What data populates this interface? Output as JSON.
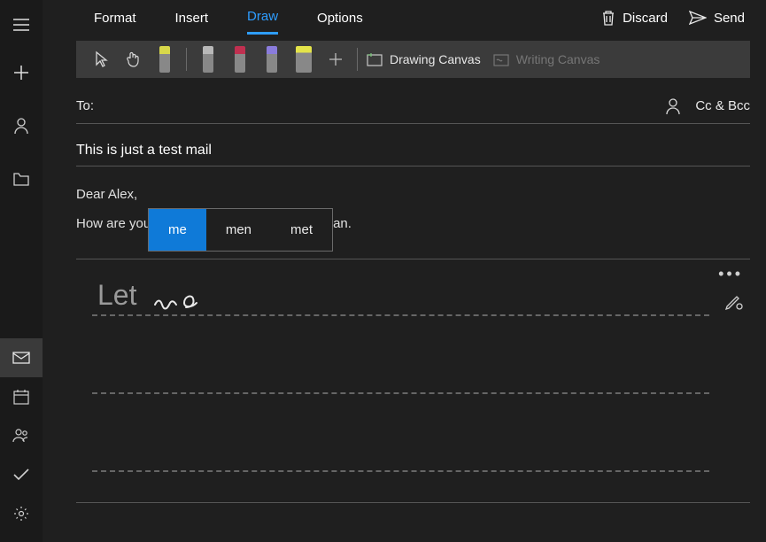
{
  "tabs": {
    "format": "Format",
    "insert": "Insert",
    "draw": "Draw",
    "options": "Options"
  },
  "actions": {
    "discard": "Discard",
    "send": "Send"
  },
  "ribbon": {
    "drawing_canvas": "Drawing Canvas",
    "writing_canvas": "Writing Canvas"
  },
  "compose": {
    "to_label": "To:",
    "ccbcc": "Cc & Bcc",
    "subject": "This is just a test mail",
    "greeting": "Dear Alex,",
    "line2": "How are you                                        ess plan."
  },
  "suggestions": {
    "opt1": "me",
    "opt2": "men",
    "opt3": "met"
  },
  "handwriting": {
    "recognized1": "Let",
    "more": "•••"
  }
}
